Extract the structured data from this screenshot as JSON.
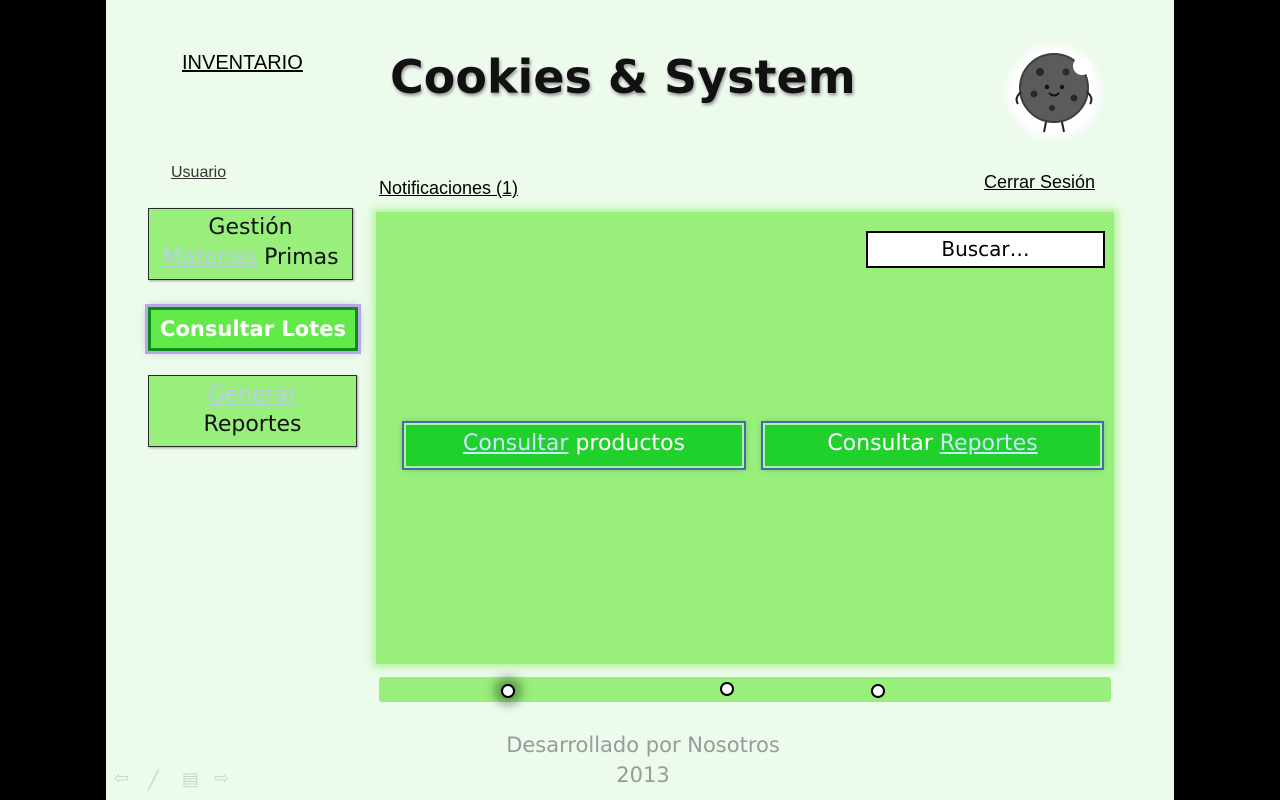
{
  "header": {
    "inventory_link": "INVENTARIO",
    "brand_title": "Cookies & System",
    "mascot_icon": "cookie-mascot-icon"
  },
  "user": {
    "label": "Usuario"
  },
  "notifications": {
    "label": "Notificaciones (1)"
  },
  "session": {
    "logout_label": "Cerrar Sesión"
  },
  "sidebar": {
    "items": [
      {
        "line1": "Gestión",
        "link_word": "Materias",
        "rest": " Primas"
      },
      {
        "label": "Consultar Lotes"
      },
      {
        "link_word": "Generar",
        "line2": "Reportes"
      }
    ]
  },
  "search": {
    "label": "Buscar…"
  },
  "actions": {
    "products": {
      "link_word": "Consultar",
      "rest": " productos"
    },
    "reports": {
      "prefix": "Consultar ",
      "link_word": "Reportes"
    }
  },
  "progress": {
    "markers": 3
  },
  "footer": {
    "line1": "Desarrollado por Nosotros",
    "line2": "2013"
  },
  "colors": {
    "background": "#ecfbec",
    "panel": "#98ef7b",
    "action_button": "#1fd12a",
    "selected_button": "#63ea4a"
  }
}
